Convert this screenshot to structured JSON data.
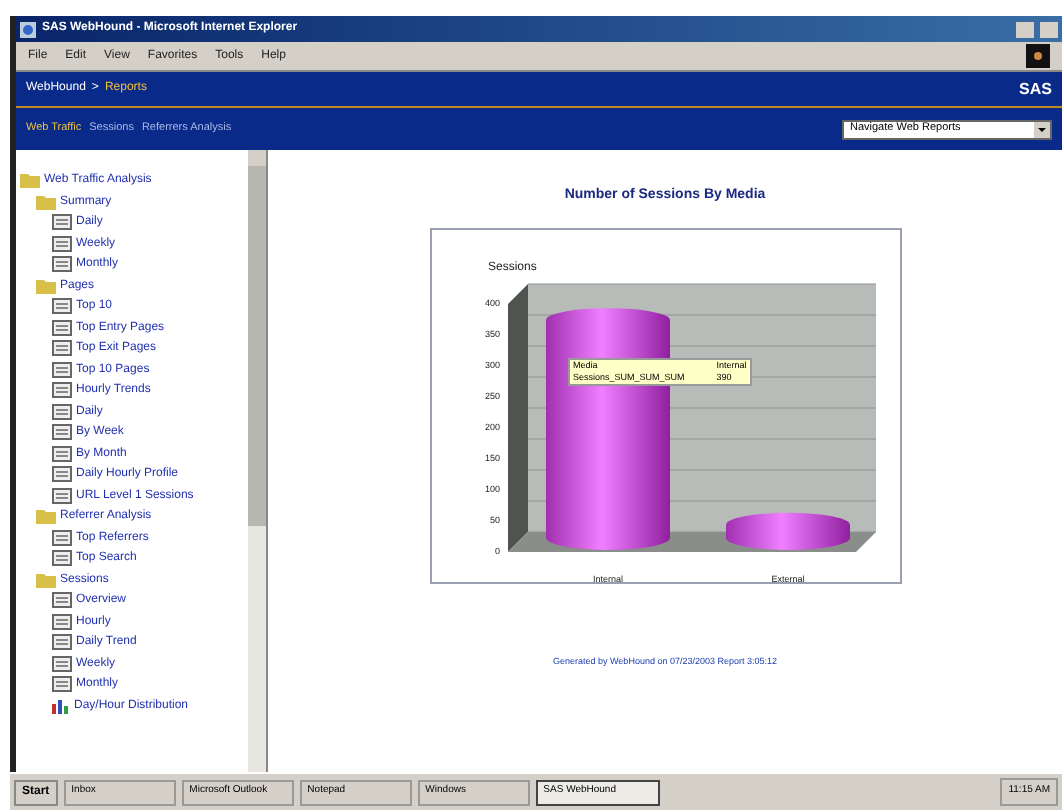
{
  "window": {
    "title": "SAS WebHound - Microsoft Internet Explorer"
  },
  "menu": [
    "File",
    "Edit",
    "View",
    "Favorites",
    "Tools",
    "Help"
  ],
  "header": {
    "breadcrumb_1": "WebHound",
    "separator": ">",
    "breadcrumb_2": "Reports",
    "logo": "SAS"
  },
  "nav": {
    "section": "Web Traffic",
    "links": [
      "Sessions",
      "Referrers Analysis"
    ],
    "select": "Navigate Web Reports"
  },
  "sidebar": {
    "items": [
      {
        "label": "Web Traffic Analysis",
        "kind": "folder",
        "children": [
          {
            "label": "Summary",
            "kind": "folder",
            "children": [
              {
                "label": "Daily",
                "kind": "report"
              },
              {
                "label": "Weekly",
                "kind": "report"
              },
              {
                "label": "Monthly",
                "kind": "report"
              }
            ]
          },
          {
            "label": "Pages",
            "kind": "folder",
            "children": [
              {
                "label": "Top 10",
                "kind": "report"
              },
              {
                "label": "Top Entry Pages",
                "kind": "report"
              },
              {
                "label": "Top Exit Pages",
                "kind": "report"
              },
              {
                "label": "Top 10 Pages",
                "kind": "report"
              },
              {
                "label": "Hourly Trends",
                "kind": "report"
              },
              {
                "label": "Daily",
                "kind": "report"
              },
              {
                "label": "By Week",
                "kind": "report"
              },
              {
                "label": "By Month",
                "kind": "report"
              },
              {
                "label": "Daily Hourly Profile",
                "kind": "report"
              },
              {
                "label": "URL Level 1 Sessions",
                "kind": "report"
              }
            ]
          },
          {
            "label": "Referrer Analysis",
            "kind": "folder",
            "children": [
              {
                "label": "Top Referrers",
                "kind": "report"
              },
              {
                "label": "Top Search",
                "kind": "report"
              }
            ]
          },
          {
            "label": "Sessions",
            "kind": "folder",
            "children": [
              {
                "label": "Overview",
                "kind": "report"
              },
              {
                "label": "Hourly",
                "kind": "report"
              },
              {
                "label": "Daily Trend",
                "kind": "report"
              },
              {
                "label": "Weekly",
                "kind": "report"
              },
              {
                "label": "Monthly",
                "kind": "report"
              },
              {
                "label": "Day/Hour Distribution",
                "kind": "chart"
              }
            ]
          }
        ]
      }
    ]
  },
  "chart_title": "Number of Sessions By Media",
  "chart": {
    "chart_data": {
      "type": "bar",
      "ylabel": "Sessions",
      "categories": [
        "Internal",
        "External"
      ],
      "values": [
        390,
        60
      ],
      "ylim": [
        0,
        400
      ],
      "yticks": [
        0,
        50,
        100,
        150,
        200,
        250,
        300,
        350,
        400
      ]
    },
    "tooltip": {
      "row_1": [
        "Media",
        "Internal"
      ],
      "row_2": [
        "Sessions_SUM_SUM_SUM",
        "390"
      ]
    }
  },
  "footer": "Generated by WebHound on 07/23/2003 Report 3:05:12",
  "taskbar": {
    "start": "Start",
    "tasks": [
      {
        "label": "Inbox",
        "selected": false
      },
      {
        "label": "Microsoft Outlook",
        "selected": false
      },
      {
        "label": "Notepad",
        "selected": false
      },
      {
        "label": "Windows",
        "selected": false
      },
      {
        "label": "SAS WebHound",
        "selected": true
      }
    ],
    "clock": "11:15 AM"
  }
}
